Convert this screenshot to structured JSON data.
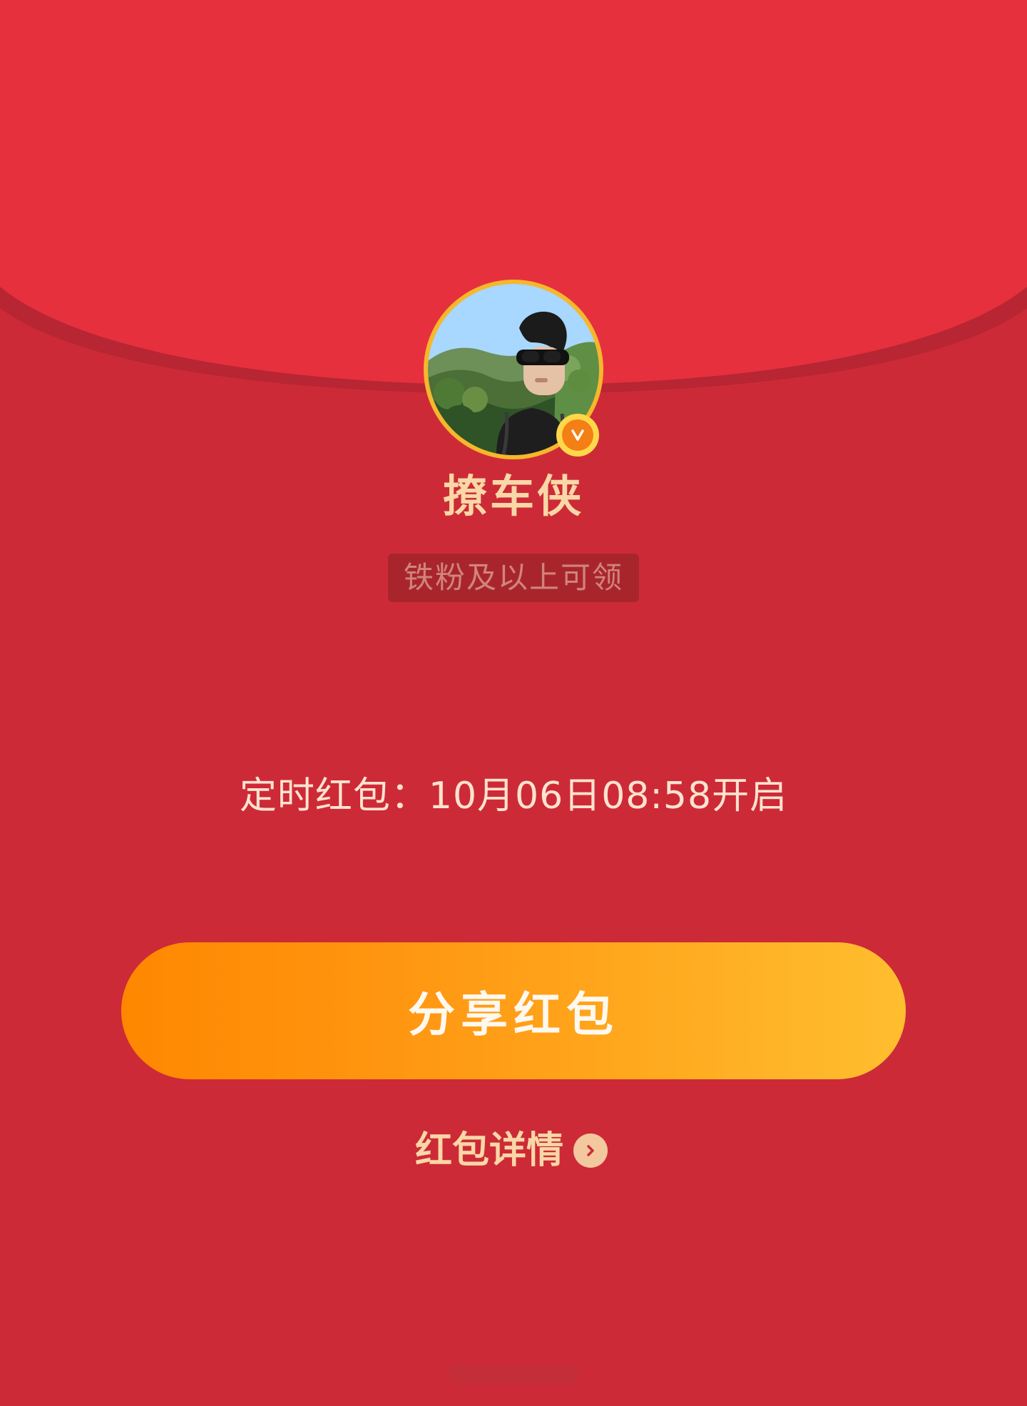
{
  "profile": {
    "name": "撩车侠",
    "avatar_icon": "profile-avatar",
    "verified_badge": "verified-icon"
  },
  "envelope": {
    "eligibility_text": "铁粉及以上可领",
    "timer_text": "定时红包：10月06日08:58开启"
  },
  "actions": {
    "share_label": "分享红包",
    "details_label": "红包详情"
  },
  "colors": {
    "envelope_red": "#cd2a37",
    "flap_red": "#e6303e",
    "gold_text": "#f9d7a7",
    "button_gradient_start": "#ff8700",
    "button_gradient_end": "#ffbe2f"
  },
  "icons": {
    "chevron": "chevron-right-icon",
    "verified": "verified-icon"
  }
}
